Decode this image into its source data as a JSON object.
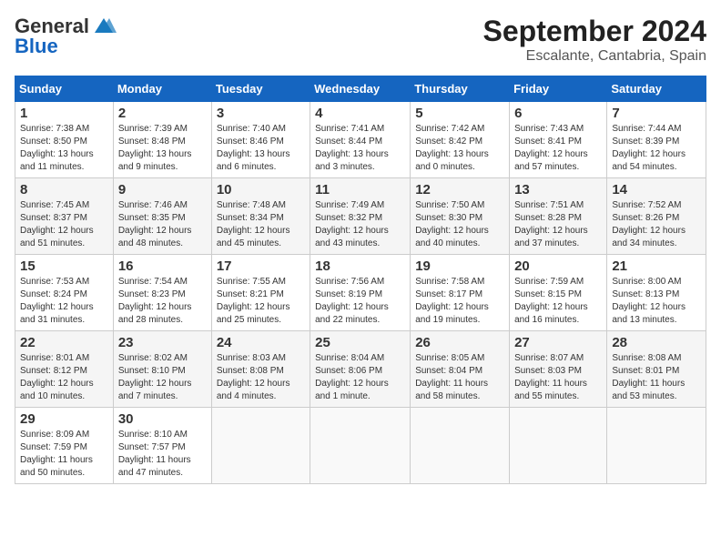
{
  "header": {
    "logo_line1": "General",
    "logo_line2": "Blue",
    "title": "September 2024",
    "subtitle": "Escalante, Cantabria, Spain"
  },
  "columns": [
    "Sunday",
    "Monday",
    "Tuesday",
    "Wednesday",
    "Thursday",
    "Friday",
    "Saturday"
  ],
  "weeks": [
    [
      {
        "day": "1",
        "info": "Sunrise: 7:38 AM\nSunset: 8:50 PM\nDaylight: 13 hours and 11 minutes."
      },
      {
        "day": "2",
        "info": "Sunrise: 7:39 AM\nSunset: 8:48 PM\nDaylight: 13 hours and 9 minutes."
      },
      {
        "day": "3",
        "info": "Sunrise: 7:40 AM\nSunset: 8:46 PM\nDaylight: 13 hours and 6 minutes."
      },
      {
        "day": "4",
        "info": "Sunrise: 7:41 AM\nSunset: 8:44 PM\nDaylight: 13 hours and 3 minutes."
      },
      {
        "day": "5",
        "info": "Sunrise: 7:42 AM\nSunset: 8:42 PM\nDaylight: 13 hours and 0 minutes."
      },
      {
        "day": "6",
        "info": "Sunrise: 7:43 AM\nSunset: 8:41 PM\nDaylight: 12 hours and 57 minutes."
      },
      {
        "day": "7",
        "info": "Sunrise: 7:44 AM\nSunset: 8:39 PM\nDaylight: 12 hours and 54 minutes."
      }
    ],
    [
      {
        "day": "8",
        "info": "Sunrise: 7:45 AM\nSunset: 8:37 PM\nDaylight: 12 hours and 51 minutes."
      },
      {
        "day": "9",
        "info": "Sunrise: 7:46 AM\nSunset: 8:35 PM\nDaylight: 12 hours and 48 minutes."
      },
      {
        "day": "10",
        "info": "Sunrise: 7:48 AM\nSunset: 8:34 PM\nDaylight: 12 hours and 45 minutes."
      },
      {
        "day": "11",
        "info": "Sunrise: 7:49 AM\nSunset: 8:32 PM\nDaylight: 12 hours and 43 minutes."
      },
      {
        "day": "12",
        "info": "Sunrise: 7:50 AM\nSunset: 8:30 PM\nDaylight: 12 hours and 40 minutes."
      },
      {
        "day": "13",
        "info": "Sunrise: 7:51 AM\nSunset: 8:28 PM\nDaylight: 12 hours and 37 minutes."
      },
      {
        "day": "14",
        "info": "Sunrise: 7:52 AM\nSunset: 8:26 PM\nDaylight: 12 hours and 34 minutes."
      }
    ],
    [
      {
        "day": "15",
        "info": "Sunrise: 7:53 AM\nSunset: 8:24 PM\nDaylight: 12 hours and 31 minutes."
      },
      {
        "day": "16",
        "info": "Sunrise: 7:54 AM\nSunset: 8:23 PM\nDaylight: 12 hours and 28 minutes."
      },
      {
        "day": "17",
        "info": "Sunrise: 7:55 AM\nSunset: 8:21 PM\nDaylight: 12 hours and 25 minutes."
      },
      {
        "day": "18",
        "info": "Sunrise: 7:56 AM\nSunset: 8:19 PM\nDaylight: 12 hours and 22 minutes."
      },
      {
        "day": "19",
        "info": "Sunrise: 7:58 AM\nSunset: 8:17 PM\nDaylight: 12 hours and 19 minutes."
      },
      {
        "day": "20",
        "info": "Sunrise: 7:59 AM\nSunset: 8:15 PM\nDaylight: 12 hours and 16 minutes."
      },
      {
        "day": "21",
        "info": "Sunrise: 8:00 AM\nSunset: 8:13 PM\nDaylight: 12 hours and 13 minutes."
      }
    ],
    [
      {
        "day": "22",
        "info": "Sunrise: 8:01 AM\nSunset: 8:12 PM\nDaylight: 12 hours and 10 minutes."
      },
      {
        "day": "23",
        "info": "Sunrise: 8:02 AM\nSunset: 8:10 PM\nDaylight: 12 hours and 7 minutes."
      },
      {
        "day": "24",
        "info": "Sunrise: 8:03 AM\nSunset: 8:08 PM\nDaylight: 12 hours and 4 minutes."
      },
      {
        "day": "25",
        "info": "Sunrise: 8:04 AM\nSunset: 8:06 PM\nDaylight: 12 hours and 1 minute."
      },
      {
        "day": "26",
        "info": "Sunrise: 8:05 AM\nSunset: 8:04 PM\nDaylight: 11 hours and 58 minutes."
      },
      {
        "day": "27",
        "info": "Sunrise: 8:07 AM\nSunset: 8:03 PM\nDaylight: 11 hours and 55 minutes."
      },
      {
        "day": "28",
        "info": "Sunrise: 8:08 AM\nSunset: 8:01 PM\nDaylight: 11 hours and 53 minutes."
      }
    ],
    [
      {
        "day": "29",
        "info": "Sunrise: 8:09 AM\nSunset: 7:59 PM\nDaylight: 11 hours and 50 minutes."
      },
      {
        "day": "30",
        "info": "Sunrise: 8:10 AM\nSunset: 7:57 PM\nDaylight: 11 hours and 47 minutes."
      },
      {
        "day": "",
        "info": ""
      },
      {
        "day": "",
        "info": ""
      },
      {
        "day": "",
        "info": ""
      },
      {
        "day": "",
        "info": ""
      },
      {
        "day": "",
        "info": ""
      }
    ]
  ]
}
